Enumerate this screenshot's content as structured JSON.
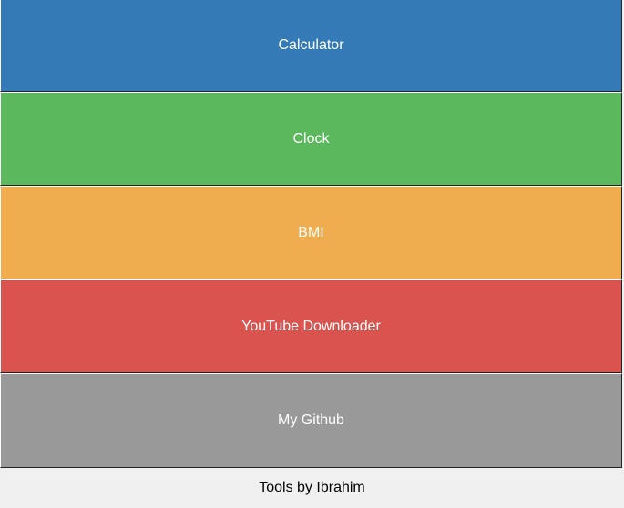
{
  "buttons": {
    "calculator": {
      "label": "Calculator",
      "color": "#337ab7"
    },
    "clock": {
      "label": "Clock",
      "color": "#5cb85c"
    },
    "bmi": {
      "label": "BMI",
      "color": "#f0ad4e"
    },
    "youtube": {
      "label": "YouTube Downloader",
      "color": "#d9534f"
    },
    "github": {
      "label": "My Github",
      "color": "#999999"
    }
  },
  "footer": {
    "text": "Tools by Ibrahim"
  }
}
